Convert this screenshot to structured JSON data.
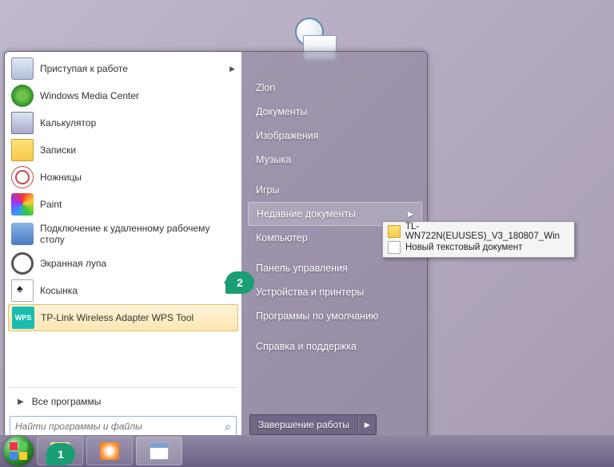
{
  "left": {
    "items": [
      {
        "label": "Приступая к работе",
        "hasSub": true
      },
      {
        "label": "Windows Media Center"
      },
      {
        "label": "Калькулятор"
      },
      {
        "label": "Записки"
      },
      {
        "label": "Ножницы"
      },
      {
        "label": "Paint"
      },
      {
        "label": "Подключение к удаленному рабочему столу"
      },
      {
        "label": "Экранная лупа"
      },
      {
        "label": "Косынка"
      },
      {
        "label": "TP-Link Wireless Adapter WPS Tool"
      }
    ],
    "all_programs": "Все программы",
    "search_placeholder": "Найти программы и файлы",
    "wps_badge": "WPS"
  },
  "right": {
    "items": [
      "Zlon",
      "Документы",
      "Изображения",
      "Музыка",
      "Игры",
      "Недавние документы",
      "Компьютер",
      "Панель управления",
      "Устройства и принтеры",
      "Программы по умолчанию",
      "Справка и поддержка"
    ],
    "recent_idx": 5,
    "shutdown": "Завершение работы"
  },
  "flyout": {
    "items": [
      "TL-WN722N(EUUSES)_V3_180807_Win",
      "Новый текстовый документ"
    ]
  },
  "badges": {
    "one": "1",
    "two": "2"
  }
}
